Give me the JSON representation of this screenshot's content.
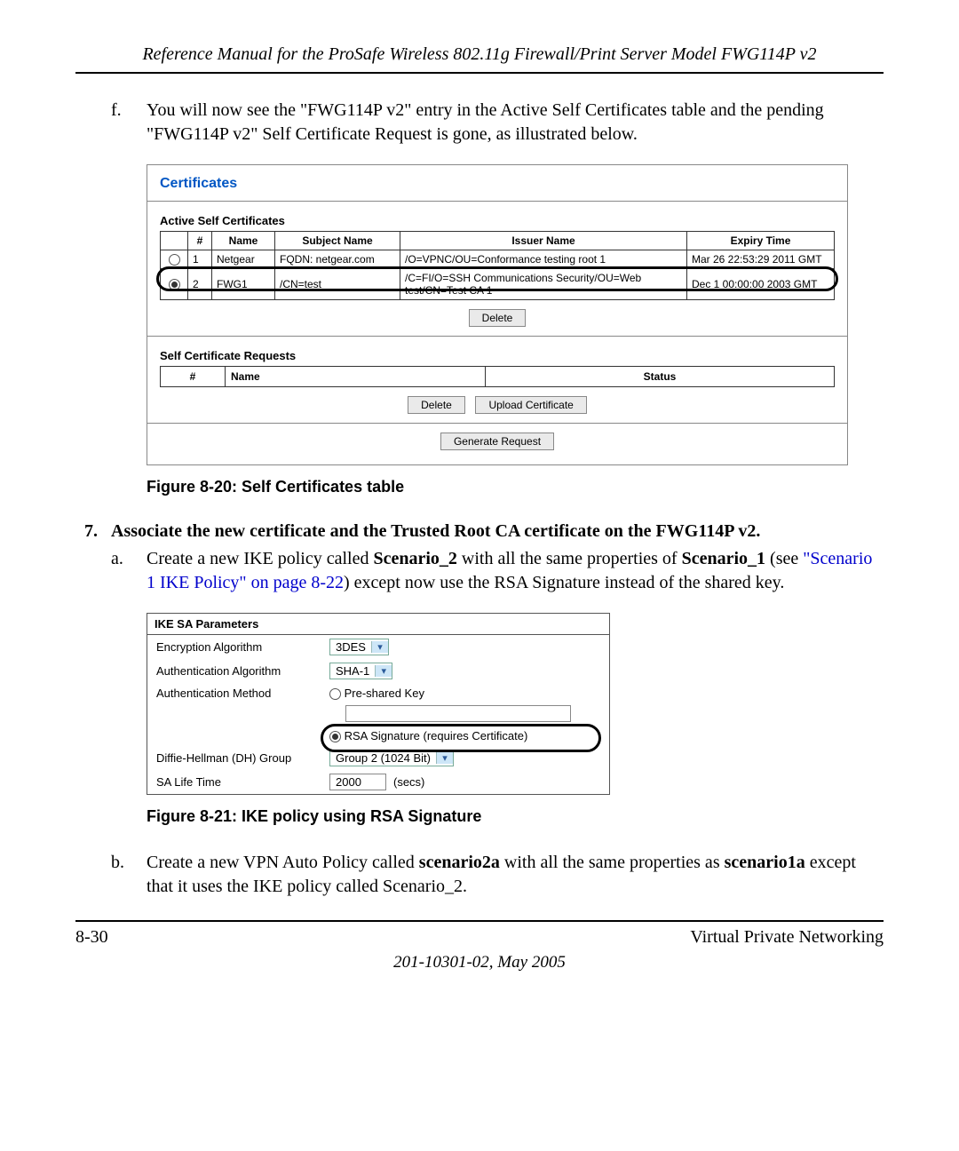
{
  "header": {
    "title": "Reference Manual for the ProSafe Wireless 802.11g  Firewall/Print Server Model FWG114P v2"
  },
  "item_f": {
    "marker": "f.",
    "text": "You will now see the \"FWG114P v2\" entry in the Active Self Certificates table and the pending \"FWG114P v2\" Self Certificate Request is gone, as illustrated below."
  },
  "fig20": {
    "title": "Certificates",
    "active_label": "Active Self Certificates",
    "headers": {
      "hash": "#",
      "name": "Name",
      "subject": "Subject Name",
      "issuer": "Issuer Name",
      "expiry": "Expiry Time"
    },
    "rows": [
      {
        "radio": false,
        "num": "1",
        "name": "Netgear",
        "subject": "FQDN: netgear.com",
        "issuer": "/O=VPNC/OU=Conformance testing root 1",
        "expiry": "Mar 26 22:53:29 2011 GMT"
      },
      {
        "radio": true,
        "num": "2",
        "name": "FWG1",
        "subject": "/CN=test",
        "issuer": "/C=FI/O=SSH Communications Security/OU=Web test/CN=Test CA 1",
        "expiry": "Dec 1 00:00:00 2003 GMT"
      }
    ],
    "delete_btn": "Delete",
    "req_label": "Self Certificate Requests",
    "req_headers": {
      "hash": "#",
      "name": "Name",
      "status": "Status"
    },
    "delete2": "Delete",
    "upload": "Upload Certificate",
    "generate": "Generate Request",
    "caption": "Figure 8-20:  Self Certificates table"
  },
  "step7": {
    "marker": "7.",
    "text": "Associate the new certificate and the Trusted Root CA certificate on the FWG114P v2."
  },
  "item_a": {
    "marker": "a.",
    "pre": "Create a new IKE policy called ",
    "bold1": "Scenario_2",
    "mid1": " with all the same properties of ",
    "bold2": "Scenario_1",
    "mid2": " (see ",
    "link": "\"Scenario 1 IKE Policy\" on page 8-22",
    "post": ") except now use the RSA Signature instead of the shared key."
  },
  "fig21": {
    "header": "IKE SA Parameters",
    "rows": {
      "enc_label": "Encryption Algorithm",
      "enc_value": "3DES",
      "auth_algo_label": "Authentication Algorithm",
      "auth_algo_value": "SHA-1",
      "auth_method_label": "Authentication Method",
      "preshared": "Pre-shared Key",
      "rsa": "RSA Signature (requires Certificate)",
      "dh_label": "Diffie-Hellman (DH) Group",
      "dh_value": "Group 2 (1024 Bit)",
      "sa_label": "SA Life Time",
      "sa_value": "2000",
      "sa_unit": "(secs)"
    },
    "caption": "Figure 8-21:  IKE policy using RSA Signature"
  },
  "item_b": {
    "marker": "b.",
    "pre": "Create a new VPN Auto Policy called ",
    "bold1": "scenario2a",
    "mid1": " with all the same properties as ",
    "bold2": "scenario1a",
    "post": " except that it uses the IKE policy called Scenario_2."
  },
  "footer": {
    "left": "8-30",
    "right": "Virtual Private Networking",
    "date": "201-10301-02, May 2005"
  }
}
